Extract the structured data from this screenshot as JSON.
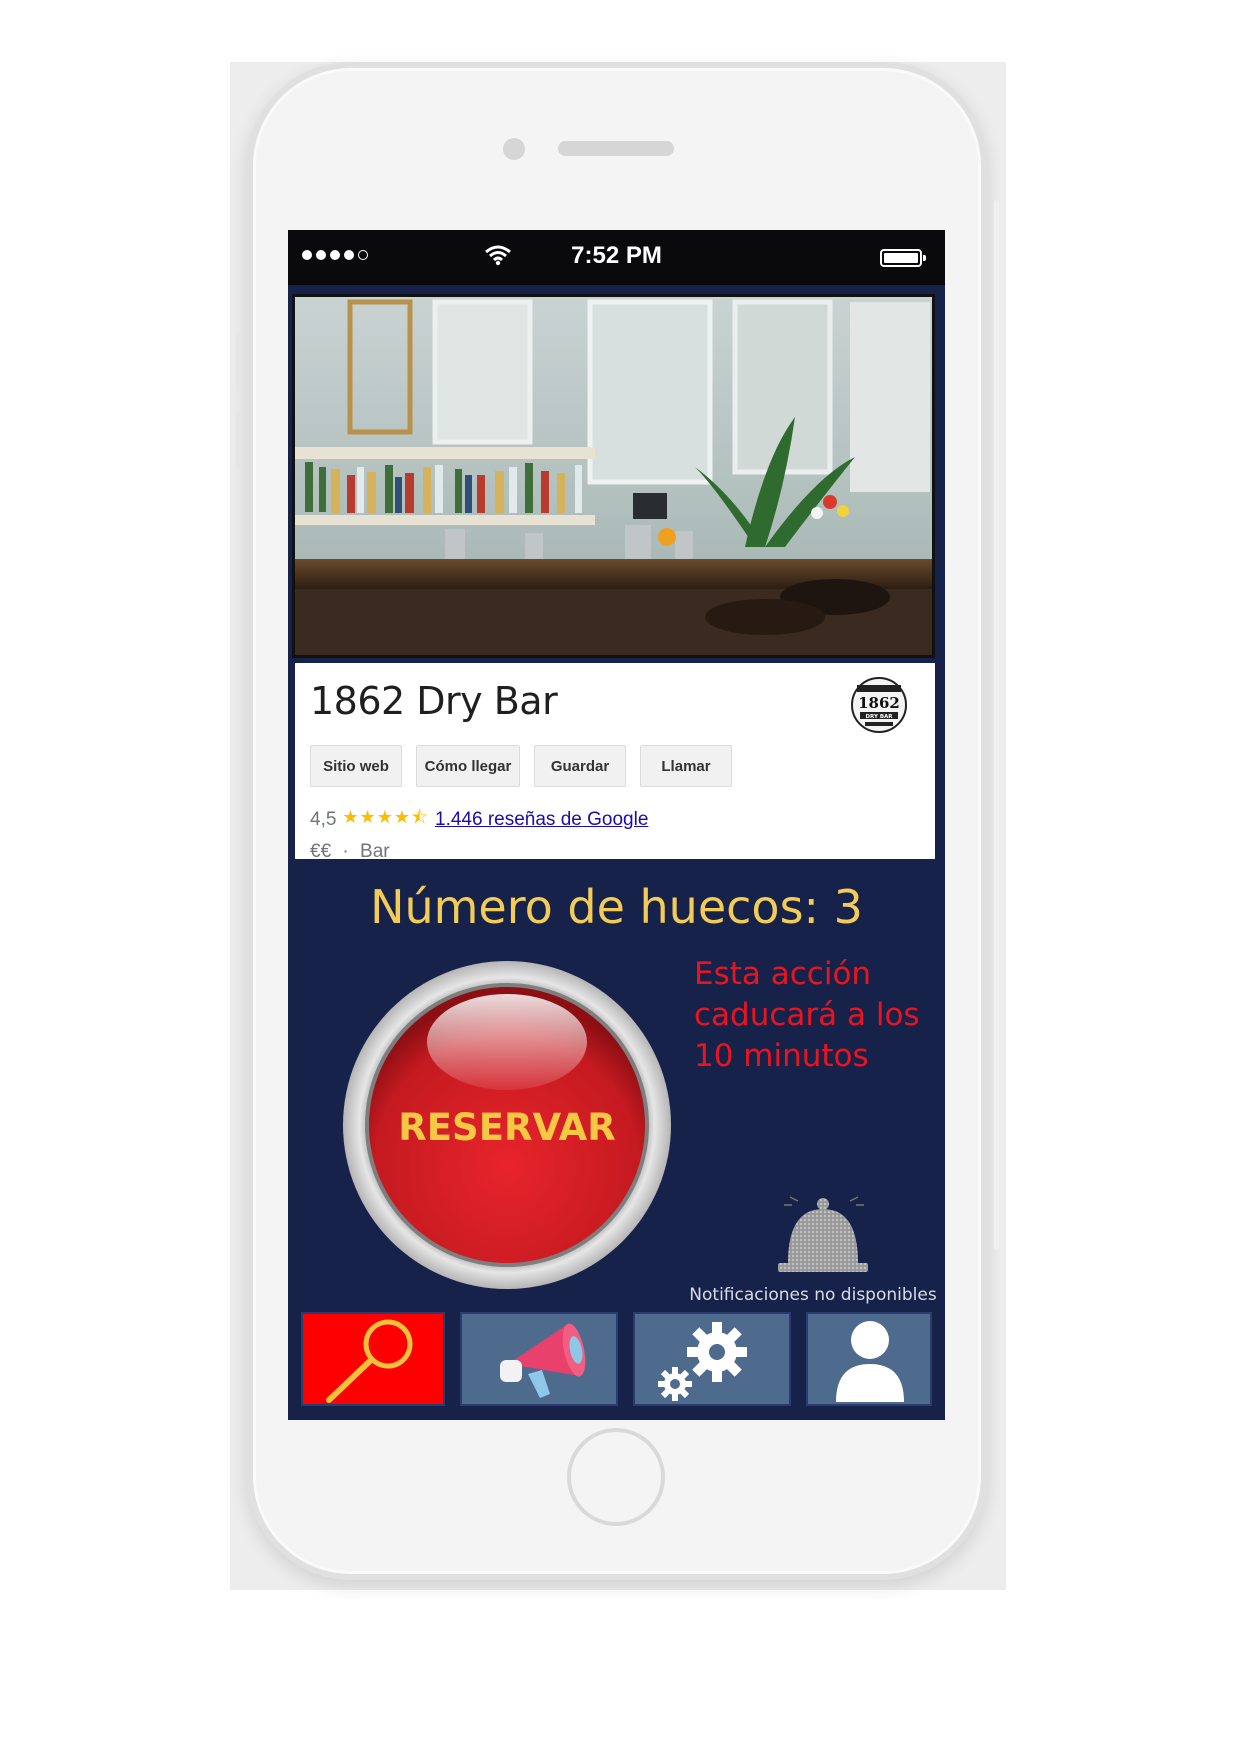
{
  "status_bar": {
    "time": "7:52 PM"
  },
  "place": {
    "name": "1862 Dry Bar",
    "logo_text_top": "1862",
    "logo_text_bottom": "DRY BAR",
    "actions": [
      "Sitio web",
      "Cómo llegar",
      "Guardar",
      "Llamar"
    ],
    "rating": "4,5",
    "rating_stars": 4.5,
    "reviews_link": "1.446 reseñas de Google",
    "price": "€€",
    "separator": "·",
    "category": "Bar"
  },
  "booking": {
    "slots_text": "Número de huecos: 3",
    "reserve_label": "RESERVAR",
    "warning_lines": [
      "Esta acción",
      "caducará a los",
      "10 minutos"
    ],
    "notifications_label": "Notificaciones no disponibles"
  },
  "tab_bar": {
    "items": [
      {
        "icon": "magnifier-icon",
        "active": true
      },
      {
        "icon": "megaphone-icon",
        "active": false
      },
      {
        "icon": "gears-icon",
        "active": false
      },
      {
        "icon": "user-icon",
        "active": false
      }
    ]
  },
  "colors": {
    "screen_background": "#17224a",
    "slots_text": "#f2cc57",
    "warning_text": "#e8141e",
    "reserve_button": "#e01e26",
    "reserve_label": "#f7c843",
    "tab_active": "#ff0000",
    "tab_inactive": "#4e6a8c"
  }
}
